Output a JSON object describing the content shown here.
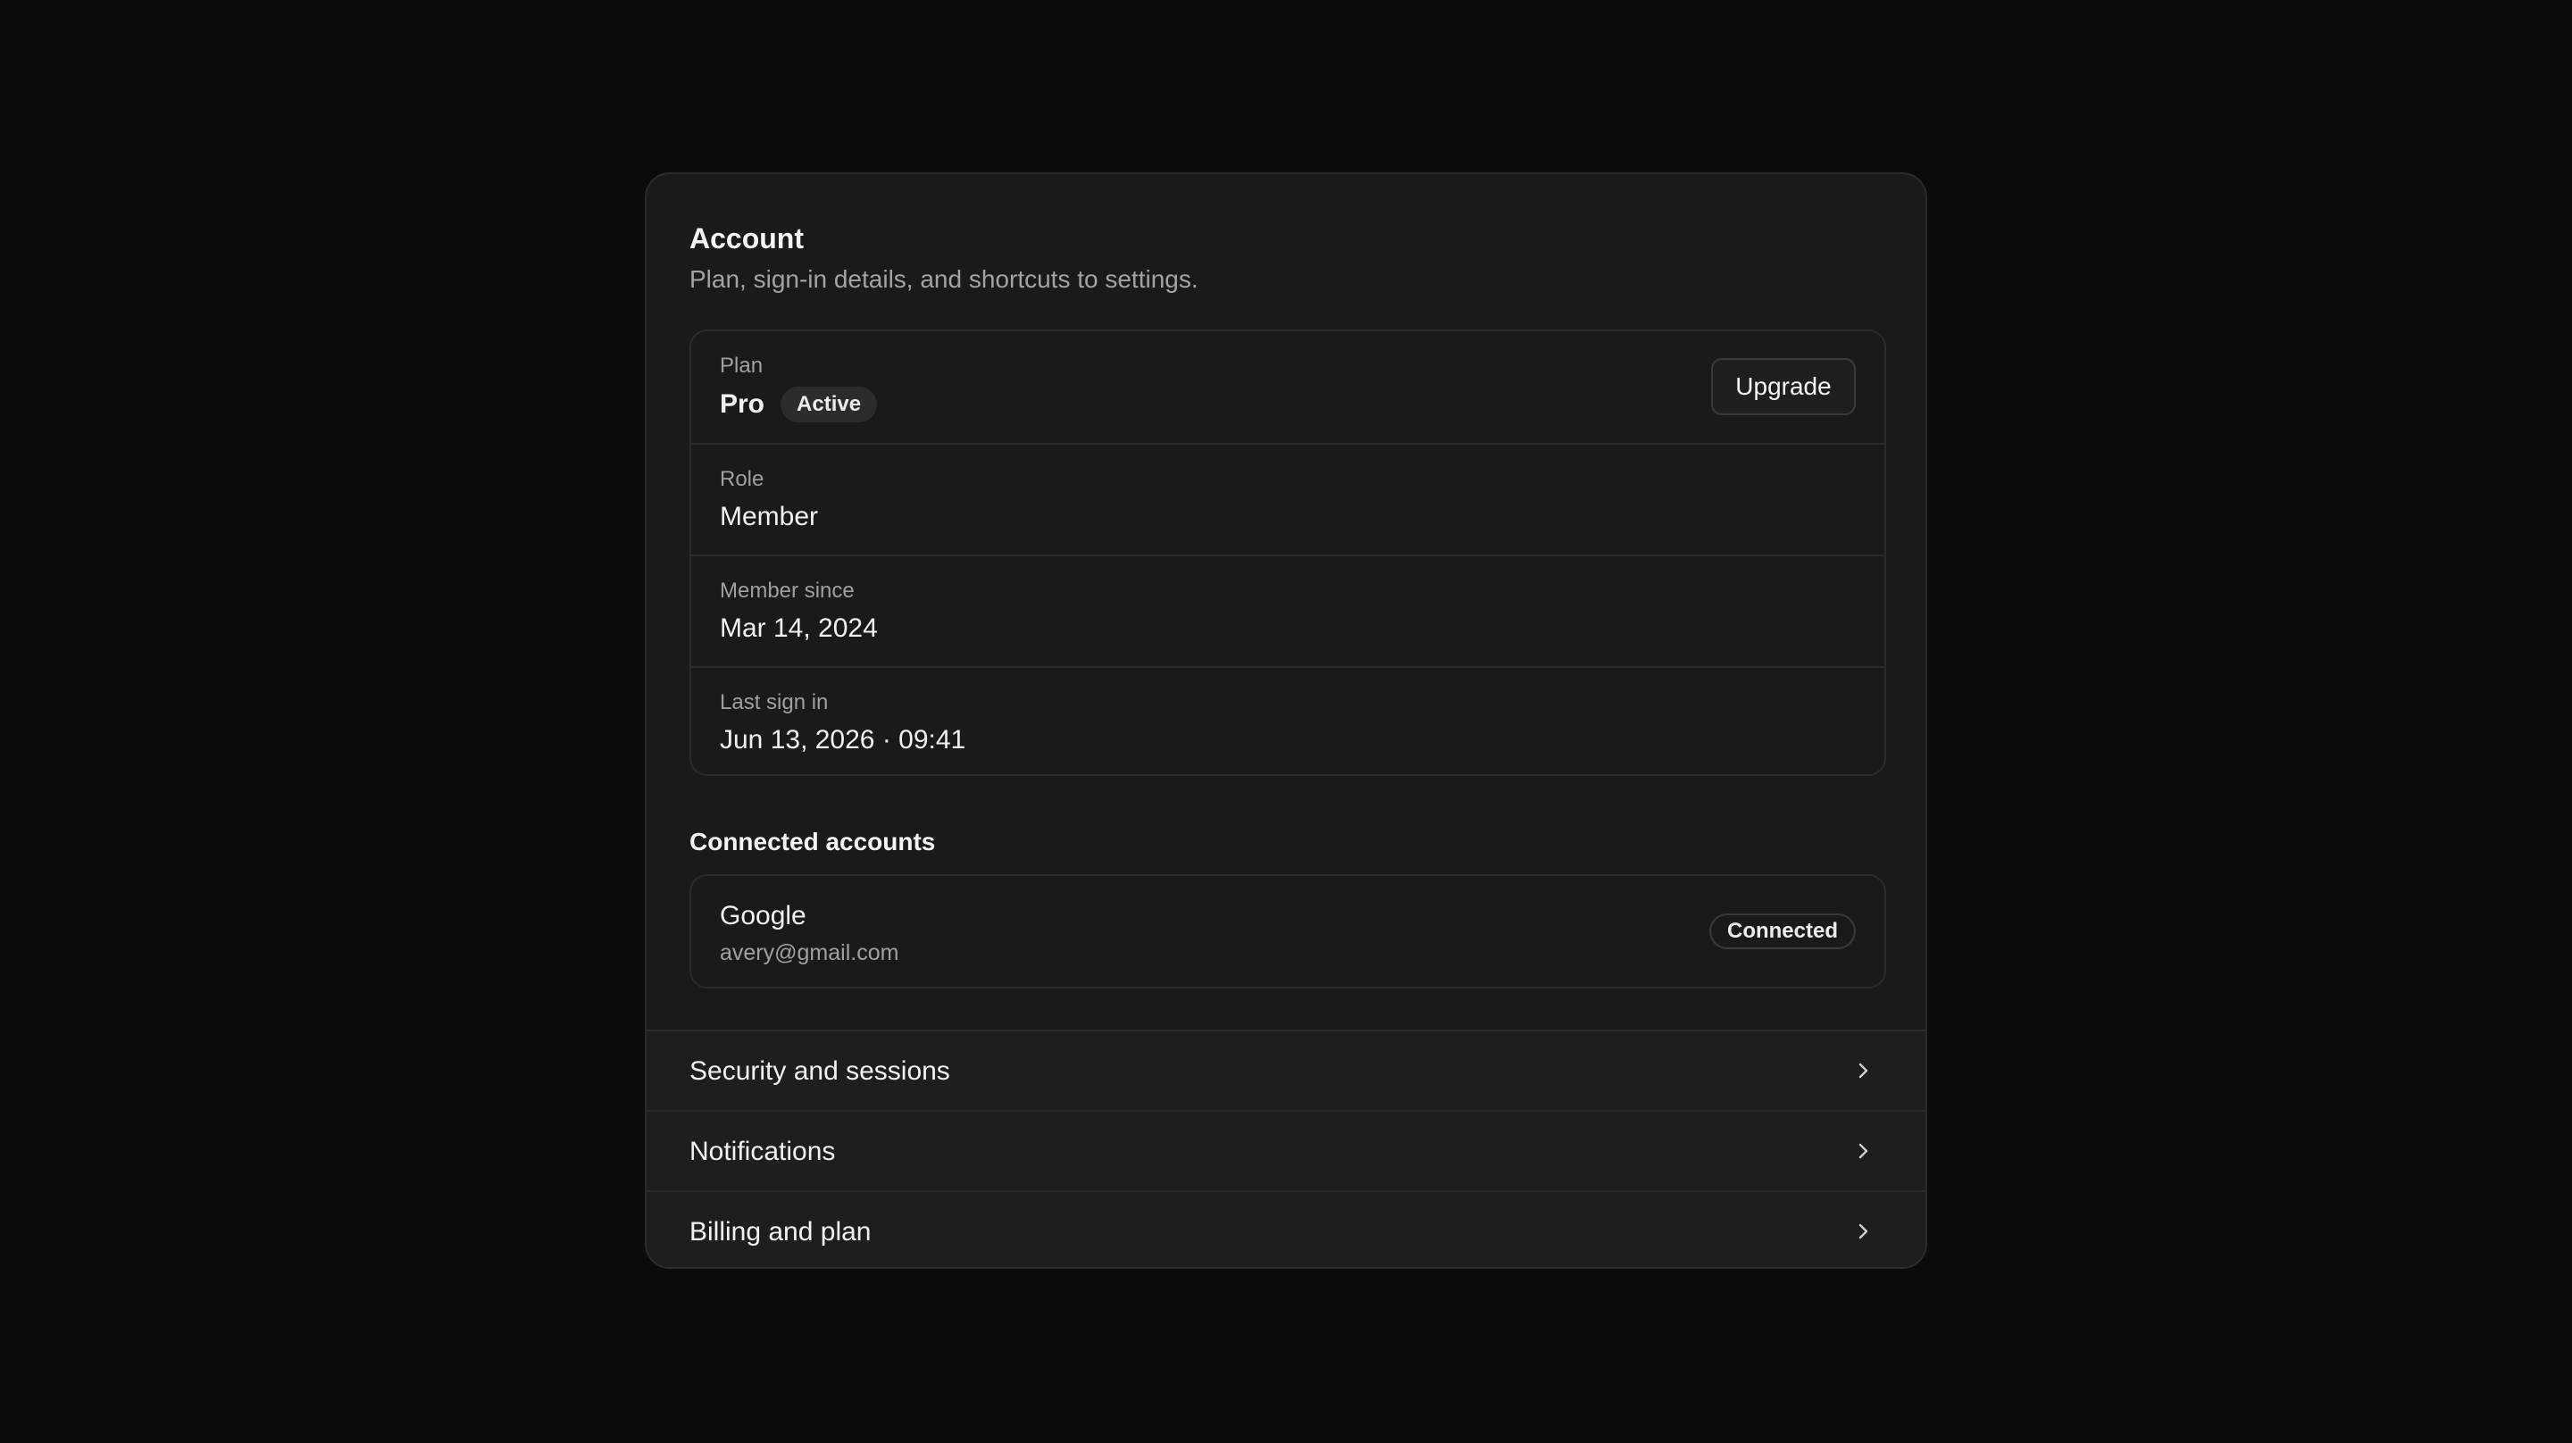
{
  "account": {
    "title": "Account",
    "subtitle": "Plan, sign-in details, and shortcuts to settings."
  },
  "details": {
    "plan": {
      "label": "Plan",
      "value": "Pro",
      "badge": "Active",
      "action": "Upgrade"
    },
    "role": {
      "label": "Role",
      "value": "Member"
    },
    "member_since": {
      "label": "Member since",
      "value": "Mar 14, 2024"
    },
    "last_sign_in": {
      "label": "Last sign in",
      "value": "Jun 13, 2026 · 09:41"
    }
  },
  "connected_accounts": {
    "title": "Connected accounts",
    "items": [
      {
        "provider": "Google",
        "email": "avery@gmail.com",
        "status": "Connected"
      }
    ]
  },
  "shortcuts": [
    {
      "label": "Security and sessions",
      "icon": "chevron-right-icon"
    },
    {
      "label": "Notifications",
      "icon": "chevron-right-icon"
    },
    {
      "label": "Billing and plan",
      "icon": "chevron-right-icon"
    }
  ],
  "colors": {
    "background": "#0b0b0b",
    "card": "#1a1a1a",
    "border": "#2b2b2b",
    "text_primary": "#f2f2f2",
    "text_secondary": "#a0a0a0"
  }
}
